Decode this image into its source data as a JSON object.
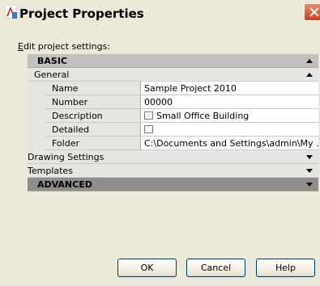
{
  "window": {
    "title": "Project Properties"
  },
  "edit_label_prefix": "E",
  "edit_label_rest": "dit project settings:",
  "grid": {
    "basic": {
      "label": "BASIC",
      "expanded": true
    },
    "general": {
      "label": "General",
      "expanded": true
    },
    "properties": [
      {
        "name": "Name",
        "value": "Sample Project 2010",
        "icon": ""
      },
      {
        "name": "Number",
        "value": "00000",
        "icon": ""
      },
      {
        "name": "Description",
        "value": "Small Office Building",
        "icon": "document-icon"
      },
      {
        "name": "Detailed Information",
        "value": "",
        "icon": "document-icon"
      },
      {
        "name": "Folder",
        "value": "C:\\Documents and Settings\\admin\\My ...",
        "icon": ""
      }
    ],
    "drawing_settings": {
      "label": "Drawing Settings",
      "expanded": false
    },
    "templates": {
      "label": "Templates",
      "expanded": false
    },
    "advanced": {
      "label": "ADVANCED",
      "expanded": false
    }
  },
  "buttons": {
    "ok": "OK",
    "cancel": "Cancel",
    "help": "Help"
  }
}
